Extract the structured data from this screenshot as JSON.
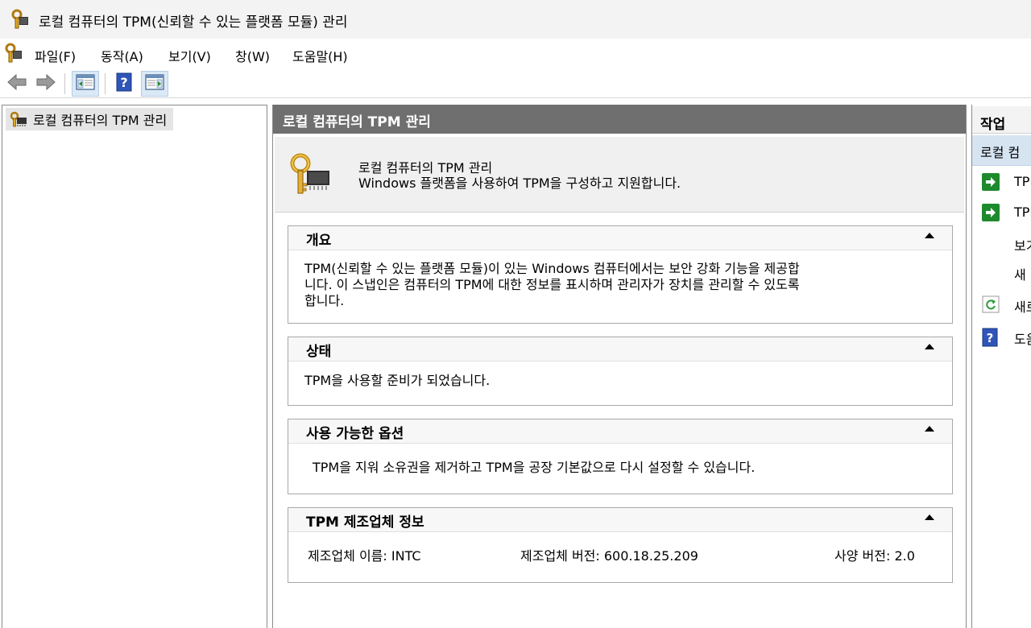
{
  "window": {
    "title": "로컬 컴퓨터의 TPM(신뢰할 수 있는 플랫폼 모듈) 관리"
  },
  "menu": [
    {
      "label": "파일(F)"
    },
    {
      "label": "동작(A)"
    },
    {
      "label": "보기(V)"
    },
    {
      "label": "창(W)"
    },
    {
      "label": "도움말(H)"
    }
  ],
  "toolbar": {
    "buttons": [
      "back-arrow-icon",
      "forward-arrow-icon",
      "show-hide-console-tree-icon",
      "help-icon",
      "show-hide-action-pane-icon"
    ]
  },
  "tree": {
    "root_label": "로컬 컴퓨터의 TPM 관리"
  },
  "center": {
    "header": "로컬 컴퓨터의 TPM 관리",
    "info_title": "로컬 컴퓨터의 TPM 관리",
    "info_subtitle": "Windows 플랫폼을 사용하여 TPM을 구성하고 지원합니다.",
    "sections": {
      "overview": {
        "title": "개요",
        "line1": "TPM(신뢰할 수 있는 플랫폼 모듈)이 있는 Windows 컴퓨터에서는 보안 강화 기능을 제공합",
        "line2": "니다. 이 스냅인은 컴퓨터의 TPM에 대한 정보를 표시하며 관리자가 장치를 관리할 수 있도록",
        "line3": "합니다."
      },
      "status": {
        "title": "상태",
        "text": "TPM을 사용할 준비가 되었습니다."
      },
      "options": {
        "title": "사용 가능한 옵션",
        "text": "TPM을 지워 소유권을 제거하고 TPM을 공장 기본값으로 다시 설정할 수 있습니다."
      },
      "manufacturer": {
        "title": "TPM 제조업체 정보",
        "name": "제조업체 이름: INTC",
        "version": "제조업체 버전: 600.18.25.209",
        "spec": "사양 버전: 2.0"
      }
    }
  },
  "actions": {
    "header": "작업",
    "group": "로컬 컴",
    "items": [
      {
        "label": "TPM",
        "icon": "green-arrow-icon"
      },
      {
        "label": "TPM",
        "icon": "green-arrow-icon"
      },
      {
        "label": "보기",
        "icon": ""
      },
      {
        "label": "새",
        "icon": ""
      },
      {
        "label": "새로",
        "icon": "refresh-icon"
      },
      {
        "label": "도움",
        "icon": "help-icon"
      }
    ]
  }
}
